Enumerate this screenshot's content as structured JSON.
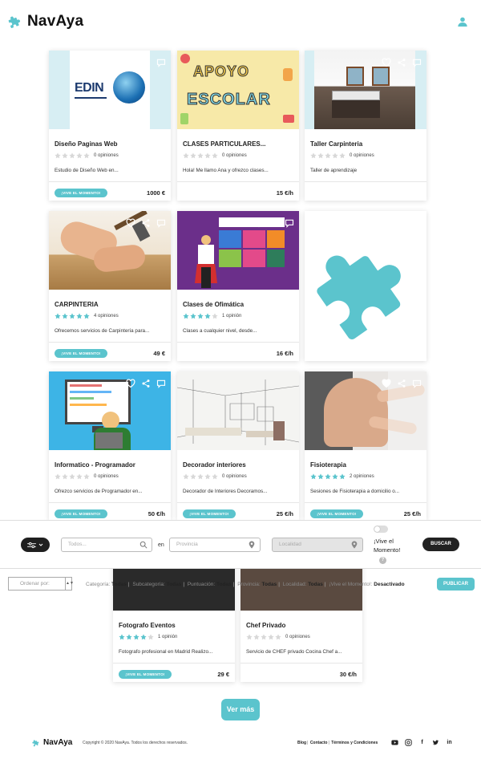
{
  "header": {
    "brand": "NavAya"
  },
  "cards": [
    {
      "title": "Diseño Paginas Web",
      "rating": 0,
      "opinions": "0 opiniones",
      "desc": "Estudio de Diseño Web en...",
      "badge": "¡VIVE EL MOMENTO!",
      "price": "1000 €",
      "image": "edin-logo"
    },
    {
      "title": "CLASES PARTICULARES...",
      "rating": 0,
      "opinions": "0 opiniones",
      "desc": "Hola! Me llamo Ana y ofrezco clases...",
      "badge": "",
      "price": "15 €/h",
      "image": "apoyo-escolar"
    },
    {
      "title": "Taller Carpinteria",
      "rating": 0,
      "opinions": "0 opiniones",
      "desc": "Taller de aprendizaje",
      "badge": "",
      "price": "",
      "image": "kitchen"
    },
    {
      "title": "CARPINTERIA",
      "rating": 5,
      "opinions": "4 opiniones",
      "desc": "Ofrecemos servicios de Carpintería para...",
      "badge": "¡VIVE EL MOMENTO!",
      "price": "49 €",
      "image": "hammer"
    },
    {
      "title": "Clases de Ofimática",
      "rating": 4,
      "opinions": "1 opinión",
      "desc": "Clases a cualquier nivel, desde...",
      "badge": "",
      "price": "16 €/h",
      "image": "office"
    },
    {
      "title": "",
      "rating": null,
      "opinions": "",
      "desc": "",
      "badge": "",
      "price": "",
      "image": "puzzle-placeholder"
    },
    {
      "title": "Informatico - Programador",
      "rating": 0,
      "opinions": "0 opiniones",
      "desc": "Ofrezco servicios de Programador en...",
      "badge": "¡VIVE EL MOMENTO!",
      "price": "50 €/h",
      "image": "programmer"
    },
    {
      "title": "Decorador interiores",
      "rating": 0,
      "opinions": "0 opiniones",
      "desc": "Decorador de Interiores Decoramos...",
      "badge": "¡VIVE EL MOMENTO!",
      "price": "25 €/h",
      "image": "interior"
    },
    {
      "title": "Fisioterapia",
      "rating": 5,
      "opinions": "2 opiniones",
      "desc": "Sesiones de Fisioterapia a domicilio o...",
      "badge": "¡VIVE EL MOMENTO!",
      "price": "25 €/h",
      "image": "physio"
    },
    {
      "title": "Fotografo Eventos",
      "rating": 4,
      "opinions": "1 opinión",
      "desc": "Fotografo profesional en Madrid Realizo...",
      "badge": "¡VIVE EL MOMENTO!",
      "price": "29 €",
      "image": "photo"
    },
    {
      "title": "Chef Privado",
      "rating": 0,
      "opinions": "0 opiniones",
      "desc": "Servicio de CHEF privado Cocina Chef a...",
      "badge": "",
      "price": "30 €/h",
      "image": "chef"
    }
  ],
  "filter_bar": {
    "search_placeholder": "Todos...",
    "en_label": "en",
    "province_placeholder": "Provincia",
    "locality_placeholder": "Localidad",
    "vive_label": "¡Vive el Momento!",
    "help": "?",
    "search_button": "BUSCAR"
  },
  "sort_row": {
    "sort_placeholder": "Ordenar por:",
    "category_label": "Categoría:",
    "category_value": "Todas",
    "subcategory_label": "Subcategoría:",
    "subcategory_value": "Todas",
    "score_label": "Puntuación:",
    "score_value": "Todas",
    "province_label": "Provincia:",
    "province_value": "Todas",
    "locality_label": "Localidad:",
    "locality_value": "Todas",
    "vive_label": "¡Vive el Momento!:",
    "vive_value": "Desactivado",
    "publish_button": "PUBLICAR"
  },
  "more_button": "Ver más",
  "footer": {
    "brand": "NavAya",
    "copyright": "Copyright © 2020 NavAya. Todos los derechos reservados.",
    "links": [
      "Blog",
      "Contacto",
      "Términos y Condiciones"
    ],
    "socials": [
      "youtube-icon",
      "instagram-icon",
      "facebook-icon",
      "twitter-icon",
      "linkedin-icon"
    ]
  },
  "colors": {
    "accent": "#5bc4cd",
    "star": "#5bc4cd",
    "star_empty": "#d8d8d8",
    "dark": "#222222"
  }
}
